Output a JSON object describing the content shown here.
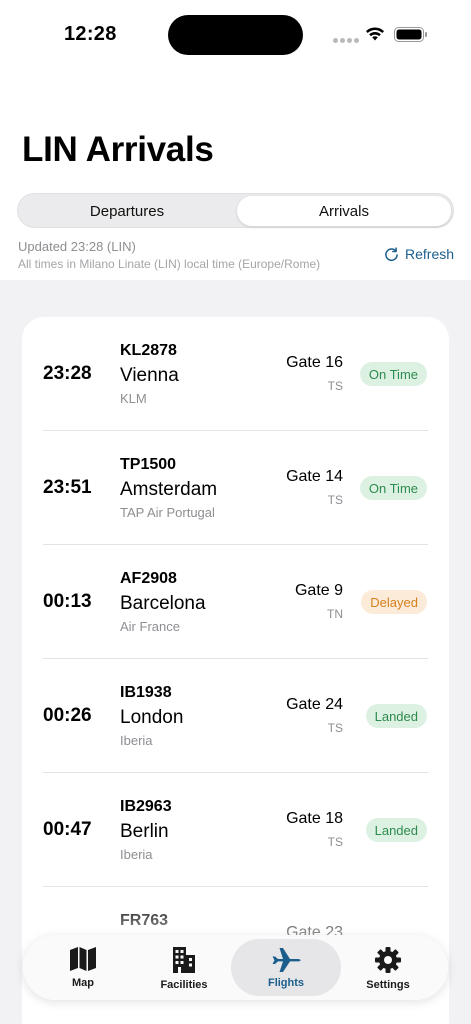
{
  "status_bar": {
    "time": "12:28"
  },
  "header": {
    "title": "LIN Arrivals"
  },
  "segments": {
    "departures": "Departures",
    "arrivals": "Arrivals",
    "selected": "Arrivals"
  },
  "info": {
    "updated": "Updated 23:28 (LIN)",
    "timezone_note": "All times in Milano Linate (LIN) local time (Europe/Rome)",
    "refresh_label": "Refresh"
  },
  "colors": {
    "accent": "#1b5e8c",
    "on_time_bg": "#ddf1e3",
    "on_time_fg": "#2e8b4e",
    "delayed_bg": "#fcebd8",
    "delayed_fg": "#d4811f",
    "landed_bg": "#ddf1e3",
    "landed_fg": "#2e8b4e"
  },
  "flights": [
    {
      "time": "23:28",
      "flight": "KL2878",
      "city": "Vienna",
      "airline": "KLM",
      "gate": "Gate 16",
      "terminal": "TS",
      "status": "On Time",
      "status_kind": "on_time"
    },
    {
      "time": "23:51",
      "flight": "TP1500",
      "city": "Amsterdam",
      "airline": "TAP Air Portugal",
      "gate": "Gate 14",
      "terminal": "TS",
      "status": "On Time",
      "status_kind": "on_time"
    },
    {
      "time": "00:13",
      "flight": "AF2908",
      "city": "Barcelona",
      "airline": "Air France",
      "gate": "Gate 9",
      "terminal": "TN",
      "status": "Delayed",
      "status_kind": "delayed"
    },
    {
      "time": "00:26",
      "flight": "IB1938",
      "city": "London",
      "airline": "Iberia",
      "gate": "Gate 24",
      "terminal": "TS",
      "status": "Landed",
      "status_kind": "landed"
    },
    {
      "time": "00:47",
      "flight": "IB2963",
      "city": "Berlin",
      "airline": "Iberia",
      "gate": "Gate 18",
      "terminal": "TS",
      "status": "Landed",
      "status_kind": "landed"
    },
    {
      "time": "",
      "flight": "FR763",
      "city": "",
      "airline": "",
      "gate": "Gate 23",
      "terminal": "",
      "status": "",
      "status_kind": "landed"
    }
  ],
  "tabbar": {
    "items": [
      {
        "label": "Map",
        "icon": "map-icon"
      },
      {
        "label": "Facilities",
        "icon": "building-icon"
      },
      {
        "label": "Flights",
        "icon": "airplane-icon"
      },
      {
        "label": "Settings",
        "icon": "gear-icon"
      }
    ],
    "active": "Flights"
  }
}
